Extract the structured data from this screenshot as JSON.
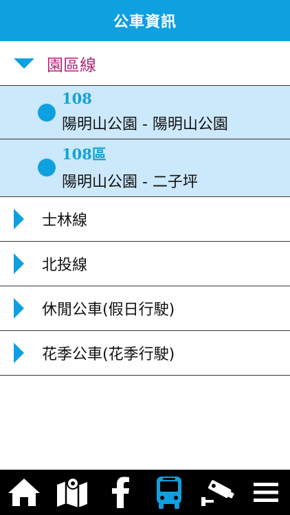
{
  "header": {
    "title": "公車資訊"
  },
  "groups": {
    "expanded": {
      "label": "園區線",
      "routes": [
        {
          "number": "108",
          "name": "陽明山公園 - 陽明山公園"
        },
        {
          "number": "108區",
          "name": "陽明山公園 - 二子坪"
        }
      ]
    },
    "collapsed": [
      {
        "label": "士林線"
      },
      {
        "label": "北投線"
      },
      {
        "label": "休閒公車(假日行駛)"
      },
      {
        "label": "花季公車(花季行駛)"
      }
    ]
  },
  "tabbar": {
    "active_color": "#0fa0e0",
    "icons": [
      "home-icon",
      "map-icon",
      "facebook-icon",
      "bus-icon",
      "camera-icon",
      "menu-icon"
    ],
    "active_index": 3
  },
  "colors": {
    "accent": "#0fa0e0",
    "group_label": "#b02a78",
    "row_highlight": "#cce8fb"
  }
}
